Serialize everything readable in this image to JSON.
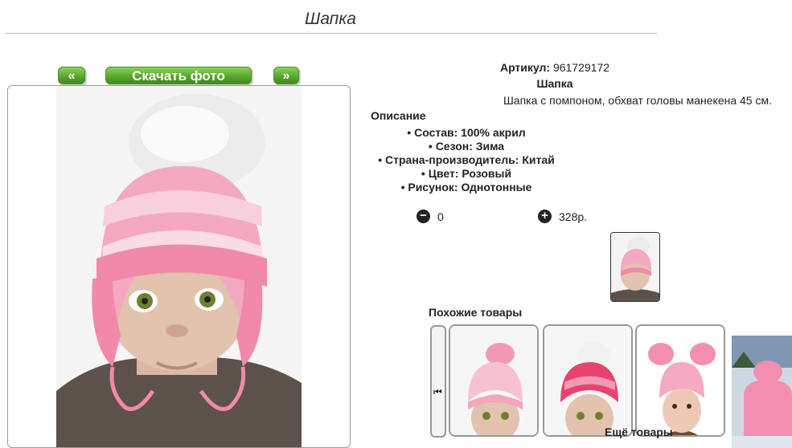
{
  "page": {
    "title": "Шапка"
  },
  "photo_nav": {
    "prev_label": "«",
    "download_label": "Скачать фото",
    "next_label": "»"
  },
  "product": {
    "article_label": "Артикул:",
    "article_number": "961729172",
    "name": "Шапка",
    "short_description": "Шапка с помпоном, обхват головы манекена 45 см.",
    "description_heading": "Описание",
    "attributes": [
      "Состав: 100% акрил",
      "Сезон: Зима",
      "Страна-производитель: Китай",
      "Цвет: Розовый",
      "Рисунок: Однотонные"
    ]
  },
  "cart": {
    "minus_icon": "minus-circle-icon",
    "quantity": "0",
    "plus_icon": "plus-circle-icon",
    "price": "328р."
  },
  "similar": {
    "title": "Похожие товары",
    "prev_icon": "skip-previous-icon",
    "more_label": "Ещё товары"
  },
  "colors": {
    "accent_green": "#5aa82e",
    "hat_pink": "#f08aa8"
  }
}
